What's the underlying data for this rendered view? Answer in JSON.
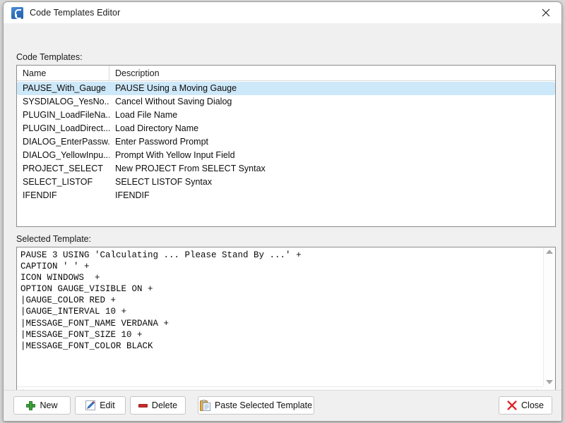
{
  "window": {
    "title": "Code Templates Editor",
    "icon": "app-icon",
    "close_icon": "close-icon"
  },
  "labels": {
    "templates": "Code Templates:",
    "selected_template": "Selected Template:"
  },
  "grid": {
    "columns": [
      "Name",
      "Description"
    ],
    "selected_index": 0,
    "rows": [
      {
        "name": "PAUSE_With_Gauge",
        "description": "PAUSE Using a Moving Gauge"
      },
      {
        "name": "SYSDIALOG_YesNo...",
        "description": "Cancel Without Saving Dialog"
      },
      {
        "name": "PLUGIN_LoadFileNa...",
        "description": "Load File Name"
      },
      {
        "name": "PLUGIN_LoadDirect...",
        "description": "Load Directory Name"
      },
      {
        "name": "DIALOG_EnterPassw...",
        "description": "Enter Password Prompt"
      },
      {
        "name": "DIALOG_YellowInpu...",
        "description": "Prompt With Yellow Input Field"
      },
      {
        "name": "PROJECT_SELECT",
        "description": "New PROJECT From SELECT Syntax"
      },
      {
        "name": "SELECT_LISTOF",
        "description": "SELECT LISTOF Syntax"
      },
      {
        "name": "IFENDIF",
        "description": "IFENDIF"
      }
    ]
  },
  "editor": {
    "code": "PAUSE 3 USING 'Calculating ... Please Stand By ...' +\nCAPTION ' ' +\nICON WINDOWS  +\nOPTION GAUGE_VISIBLE ON +\n|GAUGE_COLOR RED +\n|GAUGE_INTERVAL 10 +\n|MESSAGE_FONT_NAME VERDANA +\n|MESSAGE_FONT_SIZE 10 +\n|MESSAGE_FONT_COLOR BLACK",
    "vscroll_up_icon": "scroll-up-arrow-icon",
    "vscroll_down_icon": "scroll-down-arrow-icon",
    "hscroll_left_icon": "scroll-left-arrow-icon",
    "hscroll_right_icon": "scroll-right-arrow-icon"
  },
  "footer": {
    "new": {
      "label": "New",
      "icon": "plus-icon"
    },
    "edit": {
      "label": "Edit",
      "icon": "pencil-icon"
    },
    "delete": {
      "label": "Delete",
      "icon": "minus-icon"
    },
    "paste": {
      "label": "Paste Selected Template",
      "icon": "clipboard-icon"
    },
    "close": {
      "label": "Close",
      "icon": "red-x-icon"
    }
  },
  "colors": {
    "selection": "#cde8f9",
    "window_bg": "#f0f0f0",
    "field_bg": "#ffffff",
    "border": "#8c8c8c",
    "plus_green": "#3fa23f",
    "minus_red": "#cc2b2b",
    "close_x_red": "#e02020",
    "title_icon_blue": "#2d6fbe"
  }
}
